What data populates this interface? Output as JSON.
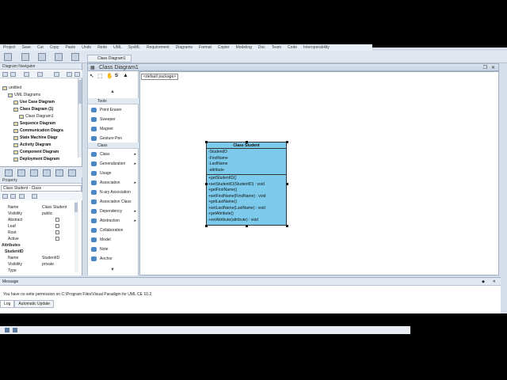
{
  "menubar": {
    "items": [
      "Project",
      "Save",
      "Cut",
      "Copy",
      "Paste",
      "Undo",
      "Redo",
      "UML",
      "SysML",
      "Requirement",
      "Diagrams",
      "Format",
      "Copier",
      "Modeling",
      "Doc",
      "Team",
      "Code",
      "Interoperability"
    ]
  },
  "navigator": {
    "title": "Diagram Navigator",
    "tree": [
      {
        "label": "untitled",
        "indent": 0,
        "bold": false
      },
      {
        "label": "UML Diagrams",
        "indent": 1,
        "bold": false
      },
      {
        "label": "Use Case Diagram",
        "indent": 2,
        "bold": true
      },
      {
        "label": "Class Diagram (1)",
        "indent": 2,
        "bold": true
      },
      {
        "label": "Class Diagram1",
        "indent": 3,
        "bold": false
      },
      {
        "label": "Sequence Diagram",
        "indent": 2,
        "bold": true
      },
      {
        "label": "Communication Diagra",
        "indent": 2,
        "bold": true
      },
      {
        "label": "State Machine Diagr",
        "indent": 2,
        "bold": true
      },
      {
        "label": "Activity Diagram",
        "indent": 2,
        "bold": true
      },
      {
        "label": "Component Diagram",
        "indent": 2,
        "bold": true
      },
      {
        "label": "Deployment Diagram",
        "indent": 2,
        "bold": true
      }
    ]
  },
  "property": {
    "title": "Property",
    "selected": "Class Student - Class",
    "rows": [
      {
        "k": "Name",
        "v": "Class Student",
        "type": "text"
      },
      {
        "k": "Visibility",
        "v": "public",
        "type": "text"
      },
      {
        "k": "Abstract",
        "v": "",
        "type": "check"
      },
      {
        "k": "Leaf",
        "v": "",
        "type": "check"
      },
      {
        "k": "Root",
        "v": "",
        "type": "check"
      },
      {
        "k": "Active",
        "v": "",
        "type": "check"
      },
      {
        "k": "Attributes",
        "v": "",
        "type": "section"
      },
      {
        "k": "StudentID",
        "v": "",
        "type": "sub"
      },
      {
        "k": "Name",
        "v": "StudentID",
        "type": "text"
      },
      {
        "k": "Visibility",
        "v": "private",
        "type": "text"
      },
      {
        "k": "Type",
        "v": "",
        "type": "text"
      }
    ]
  },
  "palette": {
    "tools_header": "Tools",
    "tools": [
      "Point Eraser",
      "Sweeper",
      "Magnet",
      "Gesture Pen"
    ],
    "class_header": "Class",
    "class_items": [
      {
        "label": "Class",
        "arrow": true
      },
      {
        "label": "Generalization",
        "arrow": true
      },
      {
        "label": "Usage",
        "arrow": false
      },
      {
        "label": "Association",
        "arrow": true
      },
      {
        "label": "N-ary Association",
        "arrow": false
      },
      {
        "label": "Association Class",
        "arrow": false
      },
      {
        "label": "Dependency",
        "arrow": true
      },
      {
        "label": "Abstraction",
        "arrow": true
      },
      {
        "label": "Collaboration",
        "arrow": false
      },
      {
        "label": "Model",
        "arrow": false
      },
      {
        "label": "Note",
        "arrow": false
      },
      {
        "label": "Anchor",
        "arrow": false
      }
    ]
  },
  "diagram": {
    "tab_label": "Class Diagram1",
    "title": "Class Diagram1",
    "package": "<default package>",
    "class": {
      "name": "Class Student",
      "attributes": [
        "-StudentID",
        "-FirstName",
        "-LastName",
        "-attribute"
      ],
      "operations": [
        "+getStudentID()",
        "+setStudentID(StudentID) : void",
        "+getFirstName()",
        "+setFirstName(FirstName) : void",
        "+getLastName()",
        "+setLastName(LastName) : void",
        "+getAttribute()",
        "+setAttribute(attribute) : void"
      ],
      "fill_color": "#7dcbec"
    }
  },
  "message": {
    "title": "Message",
    "text": "You have no write permission on C:\\Program Files\\Visual Paradigm for UML CE 10.2.",
    "tabs": [
      "Log",
      "Automatic Update"
    ]
  }
}
